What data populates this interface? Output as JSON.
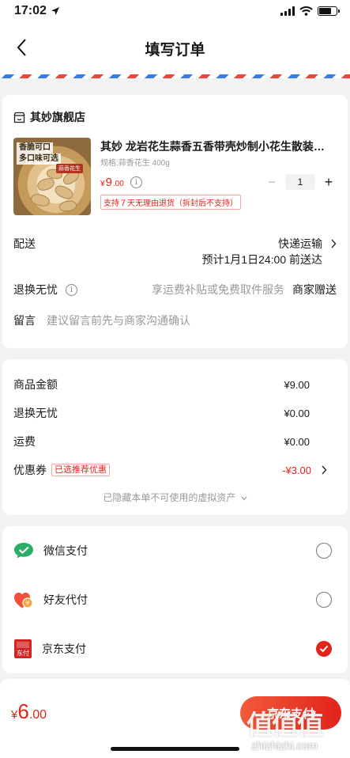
{
  "status_bar": {
    "time": "17:02"
  },
  "nav": {
    "title": "填写订单"
  },
  "shop": {
    "name": "其妙旗舰店",
    "product": {
      "thumb_text_1": "香脆可口",
      "thumb_text_2": "多口味可选",
      "thumb_text_3": "蒜香花生",
      "title": "其妙 龙岩花生蒜香五香带壳炒制小花生散装…",
      "spec": "规格:蒜香花生 400g",
      "price_currency": "¥",
      "price_int": "9",
      "price_dec": ".00",
      "quantity": "1",
      "return_badge": "支持７天无理由退货（拆封后不支持）"
    },
    "delivery": {
      "label": "配送",
      "method": "快递运输",
      "eta": "预计1月1日24:00 前送达"
    },
    "return_service": {
      "label": "退换无忧",
      "desc": "享运费补贴或免费取件服务",
      "value": "商家赠送"
    },
    "note": {
      "label": "留言",
      "placeholder": "建议留言前先与商家沟通确认"
    }
  },
  "summary": {
    "goods": {
      "label": "商品金额",
      "value": "¥9.00"
    },
    "return": {
      "label": "退换无忧",
      "value": "¥0.00"
    },
    "shipping": {
      "label": "运费",
      "value": "¥0.00"
    },
    "coupon": {
      "label": "优惠券",
      "badge": "已选推荐优惠",
      "value": "-¥3.00"
    },
    "hidden_note": "已隐藏本单不可使用的虚拟资产"
  },
  "payment": {
    "options": [
      {
        "label": "微信支付",
        "selected": false
      },
      {
        "label": "好友代付",
        "selected": false
      },
      {
        "label": "京东支付",
        "selected": true
      }
    ]
  },
  "bottom": {
    "total_currency": "¥",
    "total_int": "6",
    "total_dec": ".00",
    "pay_button": "京东支付"
  },
  "watermark": {
    "logo": "值值值",
    "url": "zhizhizhi.com"
  },
  "colors": {
    "accent": "#e2231a",
    "background": "#f2f2f2",
    "wechat_green": "#2aae67"
  }
}
